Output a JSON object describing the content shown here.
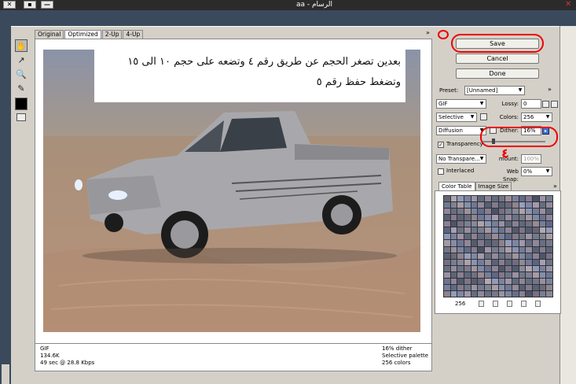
{
  "window": {
    "title": "aa - الرسام",
    "buttons": [
      "✕",
      "▪",
      "—"
    ],
    "close_glyph": "✕"
  },
  "tabs": [
    {
      "label": "Original",
      "active": false
    },
    {
      "label": "Optimized",
      "active": true
    },
    {
      "label": "2-Up",
      "active": false
    },
    {
      "label": "4-Up",
      "active": false
    }
  ],
  "menu_arrow": "»",
  "overlay_text": "بعدين تصغر الحجم عن طريق رقم ٤ وتضعه على حجم ١٠ الى ١٥ وتضغط حفظ رقم ٥",
  "info": {
    "format": "GIF",
    "size": "134.6K",
    "time": "49 sec @ 28.8 Kbps",
    "dither": "16% dither",
    "palette": "Selective palette",
    "colors": "256 colors"
  },
  "buttons": {
    "save": "Save",
    "cancel": "Cancel",
    "done": "Done"
  },
  "settings": {
    "preset_label": "Preset:",
    "preset_value": "[Unnamed]",
    "format_value": "GIF",
    "lossy_label": "Lossy:",
    "lossy_value": "0",
    "palette_value": "Selective",
    "colors_label": "Colors:",
    "colors_value": "256",
    "dither_algo": "Diffusion",
    "dither_label": "Dither:",
    "dither_value": "16%",
    "dither_level": 0.16,
    "transparency_label": "Transparency",
    "transparency_checked": true,
    "matte_value": "No Transpare...",
    "amount_label": "mount:",
    "amount_value": "100%",
    "interlaced_label": "Interlaced",
    "interlaced_checked": false,
    "websnap_label": "Web Snap:",
    "websnap_value": "0%",
    "annotation_letter": "٤"
  },
  "color_table": {
    "tabs": [
      "Color Table",
      "Image Size"
    ],
    "count": "256"
  },
  "colors": {
    "annotation_red": "#e00000",
    "active_tab": "#ffffff",
    "chrome_dark": "#3a4a5c"
  },
  "icons": {
    "hand": "hand-icon",
    "slice": "slice-select-icon",
    "zoom": "zoom-icon",
    "eyedropper": "eyedropper-icon"
  }
}
